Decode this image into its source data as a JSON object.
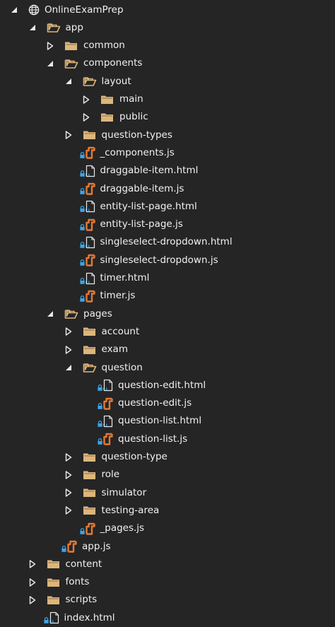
{
  "colors": {
    "background": "#252526",
    "text": "#f1f1f1",
    "folder": "#dcb67a",
    "js_file": "#e37933",
    "lock": "#3ca5e8",
    "html_file": "#e8e8e8",
    "arrow": "#e8e8e8"
  },
  "tree": [
    {
      "label": "OnlineExamPrep",
      "depth": 0,
      "type": "globe",
      "state": "expanded"
    },
    {
      "label": "app",
      "depth": 1,
      "type": "folder-open",
      "state": "expanded"
    },
    {
      "label": "common",
      "depth": 2,
      "type": "folder",
      "state": "collapsed"
    },
    {
      "label": "components",
      "depth": 2,
      "type": "folder-open",
      "state": "expanded"
    },
    {
      "label": "layout",
      "depth": 3,
      "type": "folder-open",
      "state": "expanded"
    },
    {
      "label": "main",
      "depth": 4,
      "type": "folder",
      "state": "collapsed"
    },
    {
      "label": "public",
      "depth": 4,
      "type": "folder",
      "state": "collapsed"
    },
    {
      "label": "question-types",
      "depth": 3,
      "type": "folder",
      "state": "collapsed"
    },
    {
      "label": "_components.js",
      "depth": 3,
      "type": "js",
      "state": "leaf"
    },
    {
      "label": "draggable-item.html",
      "depth": 3,
      "type": "html",
      "state": "leaf"
    },
    {
      "label": "draggable-item.js",
      "depth": 3,
      "type": "js",
      "state": "leaf"
    },
    {
      "label": "entity-list-page.html",
      "depth": 3,
      "type": "html",
      "state": "leaf"
    },
    {
      "label": "entity-list-page.js",
      "depth": 3,
      "type": "js",
      "state": "leaf"
    },
    {
      "label": "singleselect-dropdown.html",
      "depth": 3,
      "type": "html",
      "state": "leaf"
    },
    {
      "label": "singleselect-dropdown.js",
      "depth": 3,
      "type": "js",
      "state": "leaf"
    },
    {
      "label": "timer.html",
      "depth": 3,
      "type": "html",
      "state": "leaf"
    },
    {
      "label": "timer.js",
      "depth": 3,
      "type": "js",
      "state": "leaf"
    },
    {
      "label": "pages",
      "depth": 2,
      "type": "folder-open",
      "state": "expanded"
    },
    {
      "label": "account",
      "depth": 3,
      "type": "folder",
      "state": "collapsed"
    },
    {
      "label": "exam",
      "depth": 3,
      "type": "folder",
      "state": "collapsed"
    },
    {
      "label": "question",
      "depth": 3,
      "type": "folder-open",
      "state": "expanded"
    },
    {
      "label": "question-edit.html",
      "depth": 4,
      "type": "html",
      "state": "leaf"
    },
    {
      "label": "question-edit.js",
      "depth": 4,
      "type": "js",
      "state": "leaf"
    },
    {
      "label": "question-list.html",
      "depth": 4,
      "type": "html",
      "state": "leaf"
    },
    {
      "label": "question-list.js",
      "depth": 4,
      "type": "js",
      "state": "leaf"
    },
    {
      "label": "question-type",
      "depth": 3,
      "type": "folder",
      "state": "collapsed"
    },
    {
      "label": "role",
      "depth": 3,
      "type": "folder",
      "state": "collapsed"
    },
    {
      "label": "simulator",
      "depth": 3,
      "type": "folder",
      "state": "collapsed"
    },
    {
      "label": "testing-area",
      "depth": 3,
      "type": "folder",
      "state": "collapsed"
    },
    {
      "label": "_pages.js",
      "depth": 3,
      "type": "js",
      "state": "leaf"
    },
    {
      "label": "app.js",
      "depth": 2,
      "type": "js",
      "state": "leaf"
    },
    {
      "label": "content",
      "depth": 1,
      "type": "folder",
      "state": "collapsed"
    },
    {
      "label": "fonts",
      "depth": 1,
      "type": "folder",
      "state": "collapsed"
    },
    {
      "label": "scripts",
      "depth": 1,
      "type": "folder",
      "state": "collapsed"
    },
    {
      "label": "index.html",
      "depth": 1,
      "type": "html",
      "state": "leaf"
    }
  ]
}
